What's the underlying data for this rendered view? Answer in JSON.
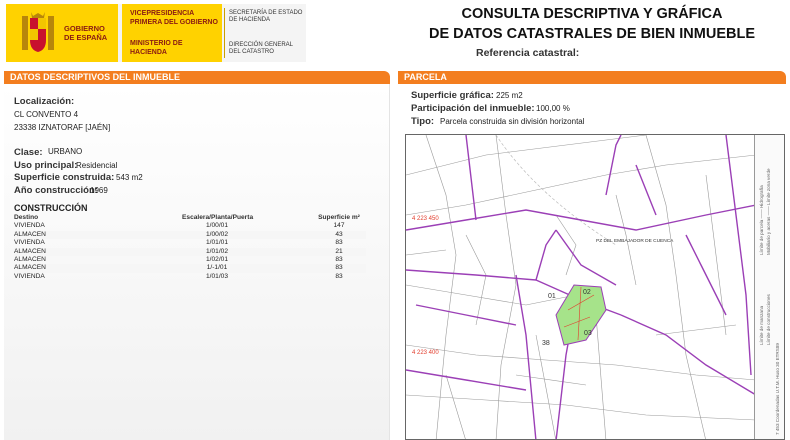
{
  "header": {
    "gobierno": "GOBIERNO DE ESPAÑA",
    "vicepresidencia": "VICEPRESIDENCIA PRIMERA DEL GOBIERNO",
    "ministerio": "MINISTERIO DE HACIENDA",
    "secretaria": "SECRETARÍA DE ESTADO DE HACIENDA",
    "direccion": "DIRECCIÓN GENERAL DEL CATASTRO",
    "title_line1": "CONSULTA DESCRIPTIVA Y GRÁFICA",
    "title_line2": "DE DATOS CATASTRALES DE BIEN INMUEBLE",
    "referencia_label": "Referencia catastral:"
  },
  "left": {
    "section_title": "DATOS DESCRIPTIVOS DEL INMUEBLE",
    "localizacion_label": "Localización:",
    "address_line1": "CL CONVENTO 4",
    "address_line2": "23338 IZNATORAF [JAÉN]",
    "clase_label": "Clase:",
    "clase_value": "URBANO",
    "uso_label": "Uso principal:",
    "uso_value": "Residencial",
    "superficie_label": "Superficie construida:",
    "superficie_value": "543 m2",
    "anio_label": "Año construcción:",
    "anio_value": "1969",
    "construccion_title": "CONSTRUCCIÓN",
    "table_headers": [
      "Destino",
      "Escalera/Planta/Puerta",
      "Superficie m²"
    ],
    "rows": [
      [
        "VIVIENDA",
        "1/00/01",
        "147"
      ],
      [
        "ALMACEN",
        "1/00/02",
        "43"
      ],
      [
        "VIVIENDA",
        "1/01/01",
        "83"
      ],
      [
        "ALMACEN",
        "1/01/02",
        "21"
      ],
      [
        "ALMACEN",
        "1/02/01",
        "83"
      ],
      [
        "ALMACEN",
        "1/-1/01",
        "83"
      ],
      [
        "VIVIENDA",
        "1/01/03",
        "83"
      ]
    ]
  },
  "right": {
    "section_title": "PARCELA",
    "superficie_grafica_label": "Superficie gráfica:",
    "superficie_grafica_value": "225 m2",
    "participacion_label": "Participación del inmueble:",
    "participacion_value": "100,00 %",
    "tipo_label": "Tipo:",
    "tipo_value": "Parcela construida sin división horizontal",
    "map": {
      "coord_top": "4 223 450",
      "coord_bottom": "4 223 400",
      "label_01": "01",
      "label_02": "02",
      "label_03": "03",
      "label_38": "38",
      "street_label": "PZ DEL EMBAJADOR DE CUENCA",
      "legend_1": "Límite de parcela —— Hidrografía",
      "legend_2": "Mobiliario y aceras —— Límite zona verde",
      "legend_3": "Límite de manzana",
      "legend_4": "Límite de construcciones",
      "legend_5": "7 453 Coordenadas U.T.M. Huso 30 ETRS89"
    }
  },
  "colors": {
    "accent_orange": "#f37e1f",
    "gov_yellow": "#ffd200",
    "parcel_purple": "#9b3fb6",
    "parcel_green": "#a6e38a"
  }
}
